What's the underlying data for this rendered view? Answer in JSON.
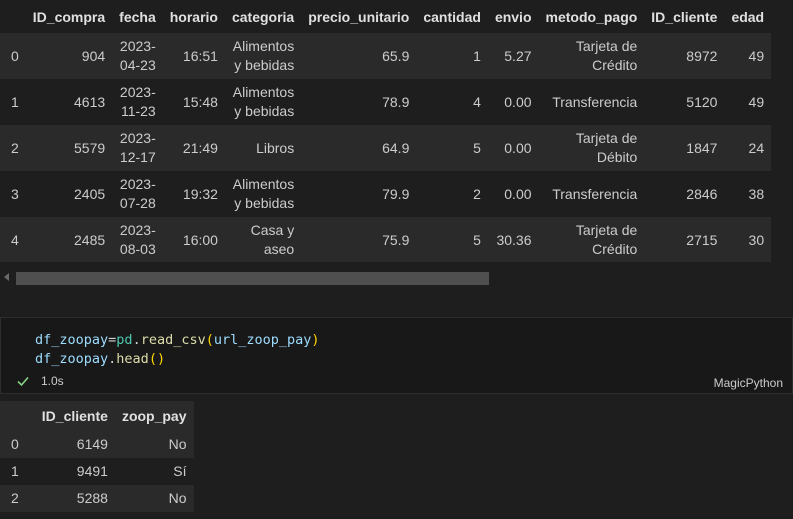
{
  "df1": {
    "columns": [
      "",
      "ID_compra",
      "fecha",
      "horario",
      "categoria",
      "precio_unitario",
      "cantidad",
      "envio",
      "metodo_pago",
      "ID_cliente",
      "edad"
    ],
    "rows": [
      {
        "index": "0",
        "ID_compra": "904",
        "fecha": [
          "2023-",
          "04-23"
        ],
        "horario": "16:51",
        "categoria": [
          "Alimentos",
          "y bebidas"
        ],
        "precio_unitario": "65.9",
        "cantidad": "1",
        "envio": "5.27",
        "metodo_pago": [
          "Tarjeta de",
          "Crédito"
        ],
        "ID_cliente": "8972",
        "edad": "49"
      },
      {
        "index": "1",
        "ID_compra": "4613",
        "fecha": [
          "2023-",
          "11-23"
        ],
        "horario": "15:48",
        "categoria": [
          "Alimentos",
          "y bebidas"
        ],
        "precio_unitario": "78.9",
        "cantidad": "4",
        "envio": "0.00",
        "metodo_pago": [
          "Transferencia"
        ],
        "ID_cliente": "5120",
        "edad": "49"
      },
      {
        "index": "2",
        "ID_compra": "5579",
        "fecha": [
          "2023-",
          "12-17"
        ],
        "horario": "21:49",
        "categoria": [
          "Libros"
        ],
        "precio_unitario": "64.9",
        "cantidad": "5",
        "envio": "0.00",
        "metodo_pago": [
          "Tarjeta de",
          "Débito"
        ],
        "ID_cliente": "1847",
        "edad": "24"
      },
      {
        "index": "3",
        "ID_compra": "2405",
        "fecha": [
          "2023-",
          "07-28"
        ],
        "horario": "19:32",
        "categoria": [
          "Alimentos",
          "y bebidas"
        ],
        "precio_unitario": "79.9",
        "cantidad": "2",
        "envio": "0.00",
        "metodo_pago": [
          "Transferencia"
        ],
        "ID_cliente": "2846",
        "edad": "38"
      },
      {
        "index": "4",
        "ID_compra": "2485",
        "fecha": [
          "2023-",
          "08-03"
        ],
        "horario": "16:00",
        "categoria": [
          "Casa y",
          "aseo"
        ],
        "precio_unitario": "75.9",
        "cantidad": "5",
        "envio": "30.36",
        "metodo_pago": [
          "Tarjeta de",
          "Crédito"
        ],
        "ID_cliente": "2715",
        "edad": "30"
      }
    ]
  },
  "code_cell": {
    "line1": {
      "var": "df_zoopay",
      "op": "=",
      "mod": "pd",
      "dot": ".",
      "fn": "read_csv",
      "open": "(",
      "arg": "url_zoop_pay",
      "close": ")"
    },
    "line2": {
      "var": "df_zoopay",
      "dot": ".",
      "fn": "head",
      "parens": "()"
    },
    "exec_time": "1.0s",
    "language": "MagicPython",
    "status_icon": "check-icon",
    "status_color": "#89d185"
  },
  "df2": {
    "columns": [
      "",
      "ID_cliente",
      "zoop_pay"
    ],
    "rows": [
      {
        "index": "0",
        "ID_cliente": "6149",
        "zoop_pay": "No"
      },
      {
        "index": "1",
        "ID_cliente": "9491",
        "zoop_pay": "Sí"
      },
      {
        "index": "2",
        "ID_cliente": "5288",
        "zoop_pay": "No"
      },
      {
        "index": "",
        "ID_cliente": "",
        "zoop_pay": ""
      }
    ]
  }
}
